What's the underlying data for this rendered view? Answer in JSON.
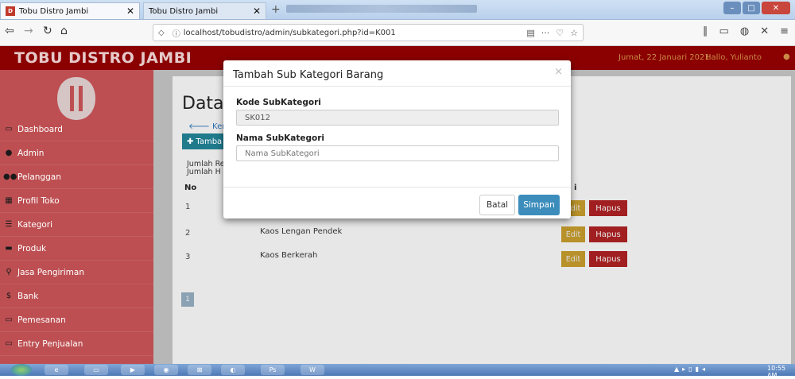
{
  "browser": {
    "active_tab": "Tobu Distro Jambi",
    "inactive_tab": "Tobu Distro Jambi",
    "url": "localhost/tobudistro/admin/subkategori.php?id=K001",
    "window_controls": [
      "minimize-icon",
      "maximize-icon",
      "close-icon"
    ]
  },
  "header": {
    "brand": "TOBU DISTRO JAMBI",
    "date": "Jumat, 22 Januari 2021",
    "greeting": "Hallo, Yulianto"
  },
  "sidebar": {
    "items": [
      {
        "label": "Dashboard",
        "icon": "monitor-icon"
      },
      {
        "label": "Admin",
        "icon": "user-icon"
      },
      {
        "label": "Pelanggan",
        "icon": "users-icon"
      },
      {
        "label": "Profil Toko",
        "icon": "grid-icon"
      },
      {
        "label": "Kategori",
        "icon": "list-icon"
      },
      {
        "label": "Produk",
        "icon": "truck-icon"
      },
      {
        "label": "Jasa Pengiriman",
        "icon": "map-marker-icon"
      },
      {
        "label": "Bank",
        "icon": "dollar-icon"
      },
      {
        "label": "Pemesanan",
        "icon": "card-icon"
      },
      {
        "label": "Entry Penjualan",
        "icon": "card-icon"
      }
    ]
  },
  "content": {
    "heading": "Data",
    "back_link": "Kemba",
    "add_button": "Tamba",
    "summary_line1": "Jumlah Re",
    "summary_line2": "Jumlah H",
    "col_no": "No",
    "col_aksi_tail": "i",
    "rows": [
      {
        "no": "1",
        "name": "",
        "edit": "Edit",
        "delete": "Hapus"
      },
      {
        "no": "2",
        "name": "Kaos Lengan Pendek",
        "edit": "Edit",
        "delete": "Hapus"
      },
      {
        "no": "3",
        "name": "Kaos Berkerah",
        "edit": "Edit",
        "delete": "Hapus"
      }
    ],
    "page": "1"
  },
  "modal": {
    "title": "Tambah Sub Kategori Barang",
    "close": "×",
    "kode_label": "Kode SubKategori",
    "kode_value": "SK012",
    "nama_label": "Nama SubKategori",
    "nama_placeholder": "Nama SubKategori",
    "cancel": "Batal",
    "save": "Simpan"
  },
  "taskbar": {
    "time": "10:55 AM"
  },
  "colors": {
    "header": "#8b0000",
    "sidebar": "#bd4f52",
    "primary": "#3c8dbc",
    "edit": "#b8912a",
    "delete": "#a11f21"
  }
}
